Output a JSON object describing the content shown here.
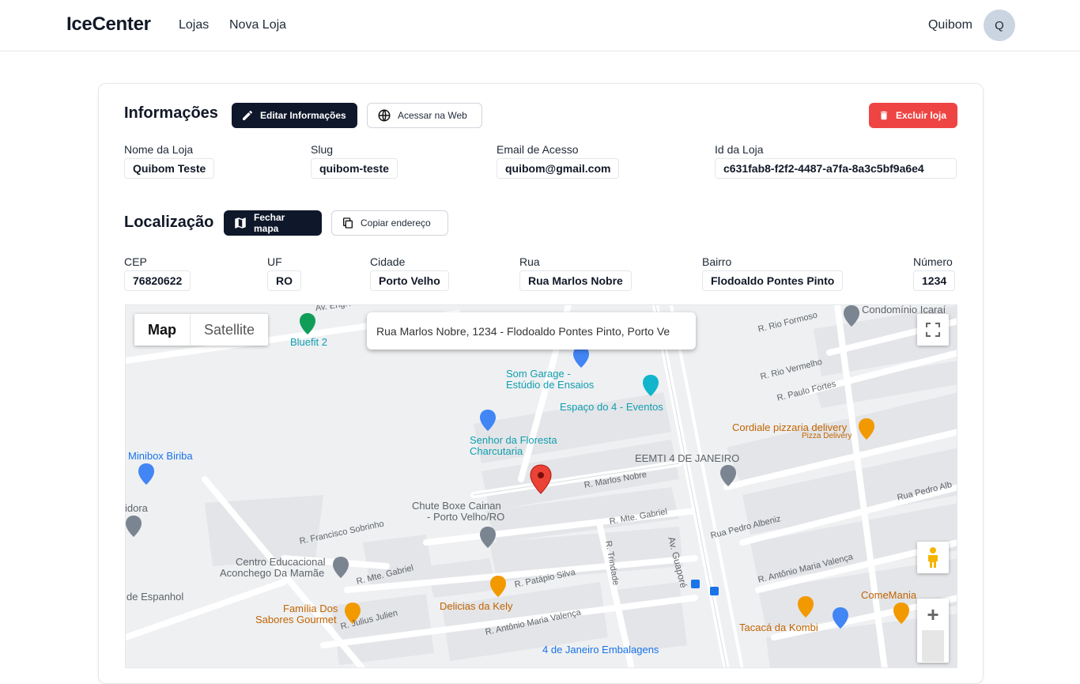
{
  "navbar": {
    "brand": "IceCenter",
    "links": [
      {
        "label": "Lojas"
      },
      {
        "label": "Nova Loja"
      }
    ],
    "user_name": "Quibom",
    "avatar_initial": "Q"
  },
  "info": {
    "title": "Informações",
    "edit_button": "Editar Informações",
    "web_button": "Acessar na Web",
    "delete_button": "Excluir loja",
    "fields": [
      {
        "label": "Nome da Loja",
        "value": "Quibom Teste"
      },
      {
        "label": "Slug",
        "value": "quibom-teste"
      },
      {
        "label": "Email de Acesso",
        "value": "quibom@gmail.com"
      },
      {
        "label": "Id da Loja",
        "value": "c631fab8-f2f2-4487-a7fa-8a3c5bf9a6e4"
      }
    ]
  },
  "location": {
    "title": "Localização",
    "map_button": "Fechar mapa",
    "copy_button": "Copiar endereço",
    "fields": [
      {
        "label": "CEP",
        "value": "76820622"
      },
      {
        "label": "UF",
        "value": "RO"
      },
      {
        "label": "Cidade",
        "value": "Porto Velho"
      },
      {
        "label": "Rua",
        "value": "Rua Marlos Nobre"
      },
      {
        "label": "Bairro",
        "value": "Flodoaldo Pontes Pinto"
      },
      {
        "label": "Número",
        "value": "1234"
      }
    ]
  },
  "map": {
    "type_map": "Map",
    "type_satellite": "Satellite",
    "address": "Rua Marlos Nobre, 1234 - Flodoaldo Pontes Pinto, Porto Ve",
    "zoom_in": "+",
    "zoom_out": "−",
    "places": {
      "bluefit": "Bluefit 2",
      "som_garage": "Som Garage -",
      "som_garage2": "Estúdio de Ensaios",
      "espaco": "Espaço do 4 - Eventos",
      "senhor": "Senhor da Floresta",
      "senhor2": "Charcutaria",
      "minibox": "Minibox Biriba",
      "eemti": "EEMTI 4 DE JANEIRO",
      "cordiale": "Cordiale pizzaria delivery",
      "cordiale2": "Pizza Delivery",
      "condominio": "Condomínio Icaraí",
      "chute": "Chute Boxe Cainan",
      "chute2": "- Porto Velho/RO",
      "centro": "Centro Educacional",
      "centro2": "Aconchego Da Mamãe",
      "familia": "Família Dos",
      "familia2": "Sabores Gourmet",
      "delicias": "Delicias da Kely",
      "comemania": "ComeMania",
      "tacaca": "Tacacá da Kombi",
      "embalagens": "4 de Janeiro Embalagens",
      "espanhol": "de Espanhol",
      "idora": "idora"
    },
    "streets": {
      "rocha": "Av. Eng. Anísio da Rocha Com",
      "rio_formoso": "R. Rio Formoso",
      "rio_vermelho": "R. Rio Vermelho",
      "paulo_fortes": "R. Paulo Fortes",
      "marlos": "R. Marlos Nobre",
      "guapore": "Av. Guaporé",
      "mte_gabriel": "R. Mte. Gabriel",
      "mte_gabriel2": "R. Mte. Gabriel",
      "francisco": "R. Francisco Sobrinho",
      "trindade": "R. Trindade",
      "patapio": "R. Patápio Silva",
      "antonio": "R. Antônio Maria Valença",
      "antonio2": "R. Antônio Maria Valença",
      "pedro": "Rua Pedro Albeniz",
      "pedro2": "Rua Pedro Alb",
      "julius": "R. Julius Julien"
    }
  }
}
